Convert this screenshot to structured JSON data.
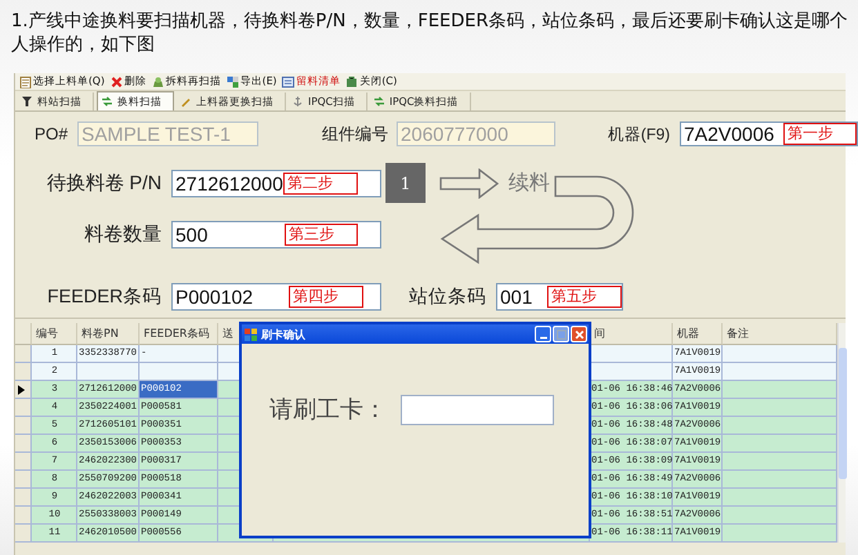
{
  "heading": "1.产线中途换料要扫描机器，待换料卷P/N，数量，FEEDER条码，站位条码，最后还要刷卡确认这是哪个人操作的，如下图",
  "toolbar": [
    {
      "kind": "select",
      "label": "选择上料单(Q)"
    },
    {
      "kind": "delete",
      "label": "删除"
    },
    {
      "kind": "rescan",
      "label": "拆料再扫描"
    },
    {
      "kind": "export",
      "label": "导出(E)"
    },
    {
      "kind": "list",
      "label": "留料清单"
    },
    {
      "kind": "close",
      "label": "关闭(C)"
    }
  ],
  "tabs": [
    {
      "kind": "funnel",
      "label": "料站扫描",
      "selected": false
    },
    {
      "kind": "swap",
      "label": "换料扫描",
      "selected": true
    },
    {
      "kind": "pencil",
      "label": "上料器更换扫描",
      "selected": false
    },
    {
      "kind": "anchor",
      "label": "IPQC扫描",
      "selected": false
    },
    {
      "kind": "swap",
      "label": "IPQC换料扫描",
      "selected": false
    }
  ],
  "form": {
    "rows": [
      {
        "fields": [
          {
            "label": "PO#",
            "value": "SAMPLE TEST-1",
            "disabled": true
          },
          {
            "label": "组件编号",
            "value": "2060777000",
            "disabled": true
          },
          {
            "label": "机器(F9)",
            "value": "7A2V0006",
            "disabled": false,
            "step": "第一步"
          }
        ]
      },
      {
        "fields": [
          {
            "label": "待换料卷 P/N",
            "value": "2712612000",
            "disabled": false,
            "step": "第二步"
          }
        ]
      },
      {
        "fields": [
          {
            "label": "料卷数量",
            "value": "500",
            "disabled": false,
            "step": "第三步"
          }
        ]
      },
      {
        "fields": [
          {
            "label": "FEEDER条码",
            "value": "P000102",
            "disabled": false,
            "step": "第四步"
          },
          {
            "label": "站位条码",
            "value": "001",
            "disabled": false,
            "step": "第五步"
          }
        ]
      }
    ],
    "counter": "1",
    "flow_label": "续料"
  },
  "table": {
    "columns": [
      "编号",
      "料卷PN",
      "FEEDER条码",
      "送",
      "间",
      "机器",
      "备注"
    ],
    "rows": [
      {
        "number": "1",
        "pn": "3352338770",
        "feeder": "-",
        "machine": "7A1V0019",
        "highlighted": false,
        "selected": false
      },
      {
        "number": "2",
        "machine": "7A1V0019",
        "highlighted": false,
        "selected": false
      },
      {
        "number": "3",
        "pn": "2712612000",
        "feeder": "P000102",
        "time": "01-06 16:38:46",
        "machine": "7A2V0006",
        "highlighted": true,
        "selected": true
      },
      {
        "number": "4",
        "pn": "2350224001",
        "feeder": "P000581",
        "time": "01-06 16:38:06",
        "machine": "7A1V0019",
        "highlighted": true,
        "selected": false
      },
      {
        "number": "5",
        "pn": "2712605101",
        "feeder": "P000351",
        "time": "01-06 16:38:48",
        "machine": "7A2V0006",
        "highlighted": true,
        "selected": false
      },
      {
        "number": "6",
        "pn": "2350153006",
        "feeder": "P000353",
        "time": "01-06 16:38:07",
        "machine": "7A1V0019",
        "highlighted": true,
        "selected": false
      },
      {
        "number": "7",
        "pn": "2462022300",
        "feeder": "P000317",
        "time": "01-06 16:38:09",
        "machine": "7A1V0019",
        "highlighted": true,
        "selected": false
      },
      {
        "number": "8",
        "pn": "2550709200",
        "feeder": "P000518",
        "time": "01-06 16:38:49",
        "machine": "7A2V0006",
        "highlighted": true,
        "selected": false
      },
      {
        "number": "9",
        "pn": "2462022003",
        "feeder": "P000341",
        "time": "01-06 16:38:10",
        "machine": "7A1V0019",
        "highlighted": true,
        "selected": false
      },
      {
        "number": "10",
        "pn": "2550338003",
        "feeder": "P000149",
        "time": "01-06 16:38:51",
        "machine": "7A2V0006",
        "highlighted": true,
        "selected": false
      },
      {
        "number": "11",
        "pn": "2462010500",
        "feeder": "P000556",
        "time": "01-06 16:38:11",
        "machine": "7A1V0019",
        "highlighted": true,
        "selected": false
      }
    ]
  },
  "dialog": {
    "title": "刷卡确认",
    "prompt": "请刷工卡："
  }
}
